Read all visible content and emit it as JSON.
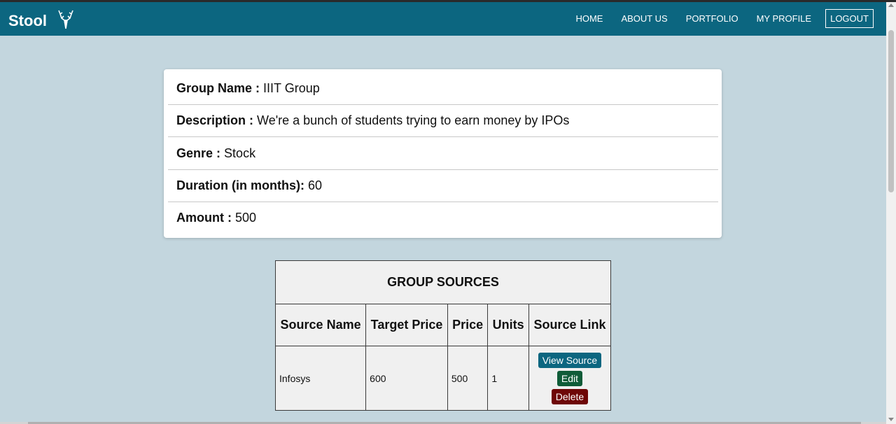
{
  "header": {
    "brand": "Stool",
    "nav": [
      "HOME",
      "ABOUT US",
      "PORTFOLIO",
      "MY PROFILE"
    ],
    "logout": "LOGOUT"
  },
  "group": {
    "name_label": "Group Name :",
    "name_value": "IIIT Group",
    "description_label": "Description :",
    "description_value": "We're a bunch of students trying to earn money by IPOs",
    "genre_label": "Genre :",
    "genre_value": "Stock",
    "duration_label": "Duration (in months):",
    "duration_value": "60",
    "amount_label": "Amount :",
    "amount_value": "500"
  },
  "sources": {
    "title": "GROUP SOURCES",
    "columns": [
      "Source Name",
      "Target Price",
      "Price",
      "Units",
      "Source Link"
    ],
    "rows": [
      {
        "source_name": "Infosys",
        "target_price": "600",
        "price": "500",
        "units": "1",
        "view_label": "View Source",
        "edit_label": "Edit",
        "delete_label": "Delete"
      }
    ]
  },
  "colors": {
    "navbar": "#0c6680",
    "page_background": "#c3d6de",
    "view_button": "#0c6680",
    "edit_button": "#0f5c38",
    "delete_button": "#6e0707"
  },
  "icons": [
    "deer-antler-logo-icon"
  ]
}
